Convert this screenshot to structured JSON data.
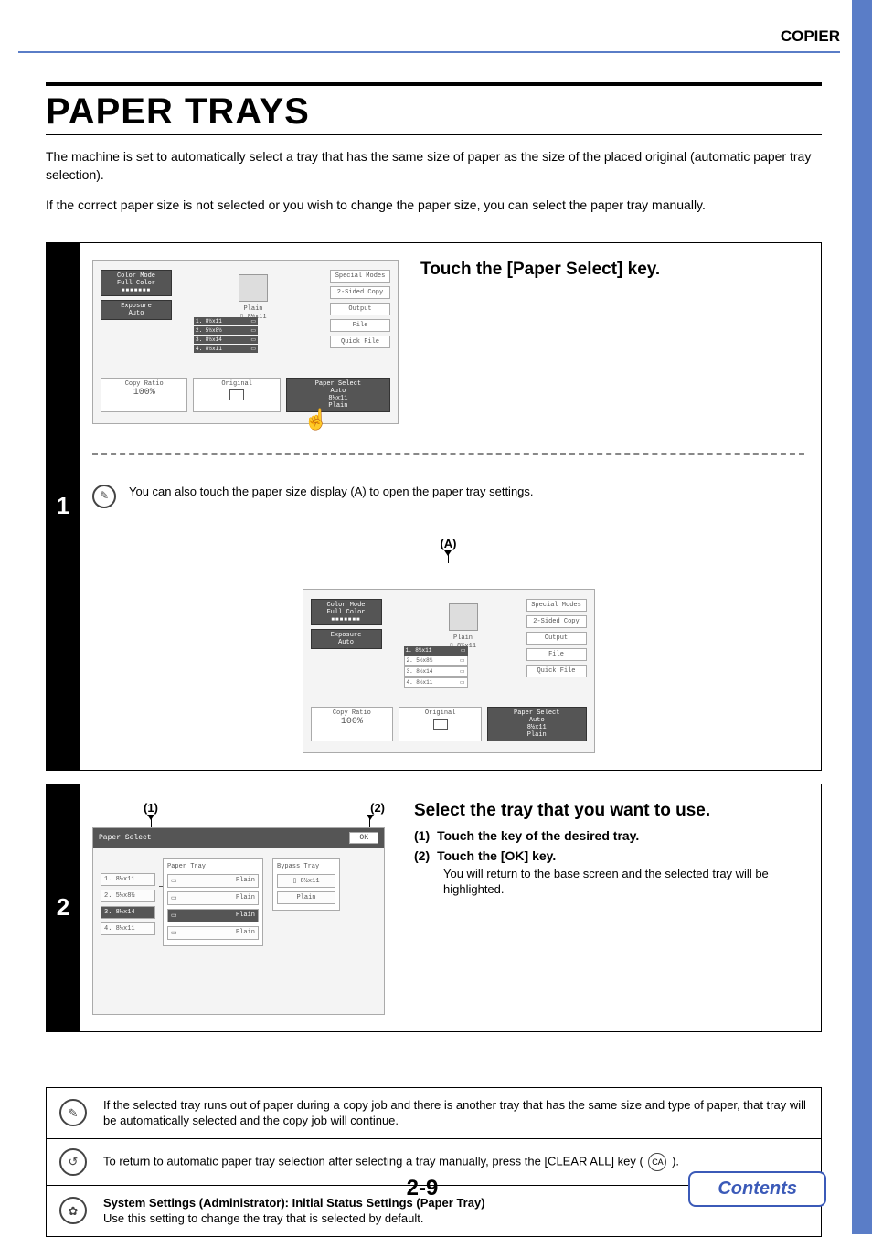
{
  "header": {
    "section": "COPIER"
  },
  "title": "PAPER TRAYS",
  "intro_line1": "The machine is set to automatically select a tray that has the same size of paper as the size of the placed original (automatic paper tray selection).",
  "intro_line2": "If the correct paper size is not selected or you wish to change the paper size, you can select the paper tray manually.",
  "step1": {
    "number": "1",
    "title": "Touch the [Paper Select] key.",
    "note": "You can also touch the paper size display (A) to open the paper tray settings.",
    "callout_a": "(A)",
    "screen": {
      "color_mode_label": "Color Mode",
      "color_mode_value": "Full Color",
      "exposure_label": "Exposure",
      "exposure_value": "Auto",
      "copy_ratio_label": "Copy Ratio",
      "copy_ratio_value": "100%",
      "original_label": "Original",
      "paper_select_label": "Paper Select",
      "paper_select_value1": "Auto",
      "paper_select_value2": "8½x11",
      "paper_select_value3": "Plain",
      "center_type": "Plain",
      "center_size": "8½x11",
      "tray_list": [
        {
          "num": "1.",
          "size": "8½x11"
        },
        {
          "num": "2.",
          "size": "5½x8½"
        },
        {
          "num": "3.",
          "size": "8½x14"
        },
        {
          "num": "4.",
          "size": "8½x11"
        }
      ],
      "right_buttons": {
        "special_modes": "Special Modes",
        "two_sided": "2-Sided Copy",
        "output": "Output",
        "file": "File",
        "quick_file": "Quick File"
      }
    }
  },
  "step2": {
    "number": "2",
    "title": "Select the tray that you want to use.",
    "sub1_num": "(1)",
    "sub1_text": "Touch the key of the desired tray.",
    "sub2_num": "(2)",
    "sub2_text": "Touch the [OK] key.",
    "sub2_detail": "You will return to the base screen and the selected tray will be highlighted.",
    "annot1": "(1)",
    "annot2": "(2)",
    "screen": {
      "title": "Paper Select",
      "ok": "OK",
      "paper_tray_head": "Paper Tray",
      "bypass_tray_head": "Bypass Tray",
      "trays": [
        {
          "label": "1. 8½x11",
          "type": "Plain"
        },
        {
          "label": "2. 5½x8½",
          "type": "Plain"
        },
        {
          "label": "3. 8½x14",
          "type": "Plain"
        },
        {
          "label": "4. 8½x11",
          "type": "Plain"
        }
      ],
      "bypass_size": "8½x11",
      "bypass_type": "Plain"
    }
  },
  "notes": {
    "n1": "If the selected tray runs out of paper during a copy job and there is another tray that has the same size and type of paper, that tray will be automatically selected and the copy job will continue.",
    "n2_a": "To return to automatic paper tray selection after selecting a tray manually, press the [CLEAR ALL] key (",
    "n2_ca": "CA",
    "n2_b": ").",
    "n3_title": "System Settings (Administrator): Initial Status Settings (Paper Tray)",
    "n3_body": "Use this setting to change the tray that is selected by default."
  },
  "page_number": "2-9",
  "contents_label": "Contents"
}
